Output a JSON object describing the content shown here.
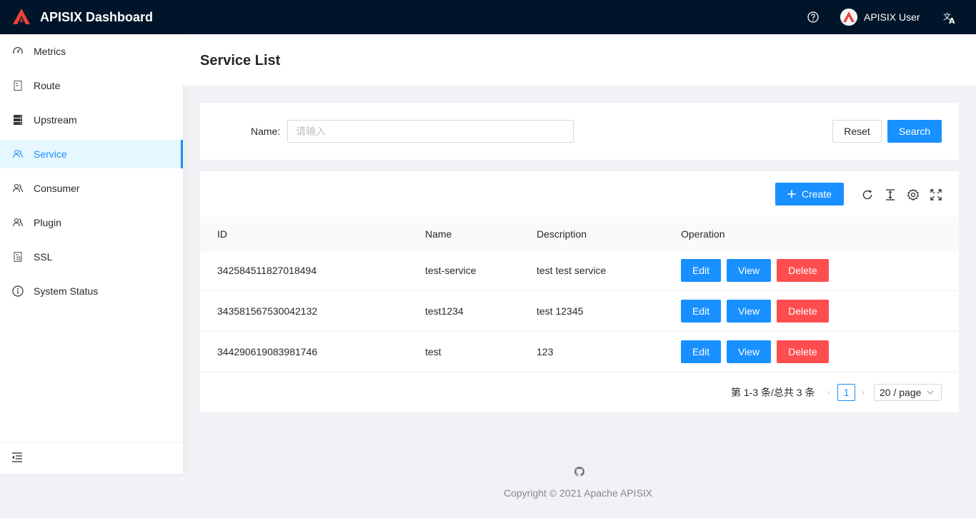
{
  "header": {
    "title": "APISIX Dashboard",
    "user_name": "APISIX User",
    "bg_color": "#001529",
    "logo_color": "#e8433e"
  },
  "sidebar": {
    "items": [
      {
        "label": "Metrics",
        "icon": "dashboard-icon"
      },
      {
        "label": "Route",
        "icon": "route-icon"
      },
      {
        "label": "Upstream",
        "icon": "database-icon"
      },
      {
        "label": "Service",
        "icon": "service-icon",
        "active": true
      },
      {
        "label": "Consumer",
        "icon": "team-icon"
      },
      {
        "label": "Plugin",
        "icon": "plugin-icon"
      },
      {
        "label": "SSL",
        "icon": "ssl-icon"
      },
      {
        "label": "System Status",
        "icon": "info-circle-icon"
      }
    ]
  },
  "page": {
    "title": "Service List"
  },
  "search": {
    "name_label": "Name",
    "name_placeholder": "请输入",
    "reset_label": "Reset",
    "search_label": "Search"
  },
  "table": {
    "create_label": "Create",
    "columns": [
      "ID",
      "Name",
      "Description",
      "Operation"
    ],
    "rows": [
      {
        "id": "342584511827018494",
        "name": "test-service",
        "description": "test test service"
      },
      {
        "id": "343581567530042132",
        "name": "test1234",
        "description": "test 12345"
      },
      {
        "id": "344290619083981746",
        "name": "test",
        "description": "123"
      }
    ],
    "actions": {
      "edit": "Edit",
      "view": "View",
      "delete": "Delete"
    }
  },
  "pagination": {
    "total_text": "第 1-3 条/总共 3 条",
    "current_page": "1",
    "page_size": "20 / page"
  },
  "footer": {
    "copyright": "Copyright © 2021 Apache APISIX"
  },
  "colors": {
    "primary": "#1890ff",
    "danger": "#ff4d4f"
  }
}
